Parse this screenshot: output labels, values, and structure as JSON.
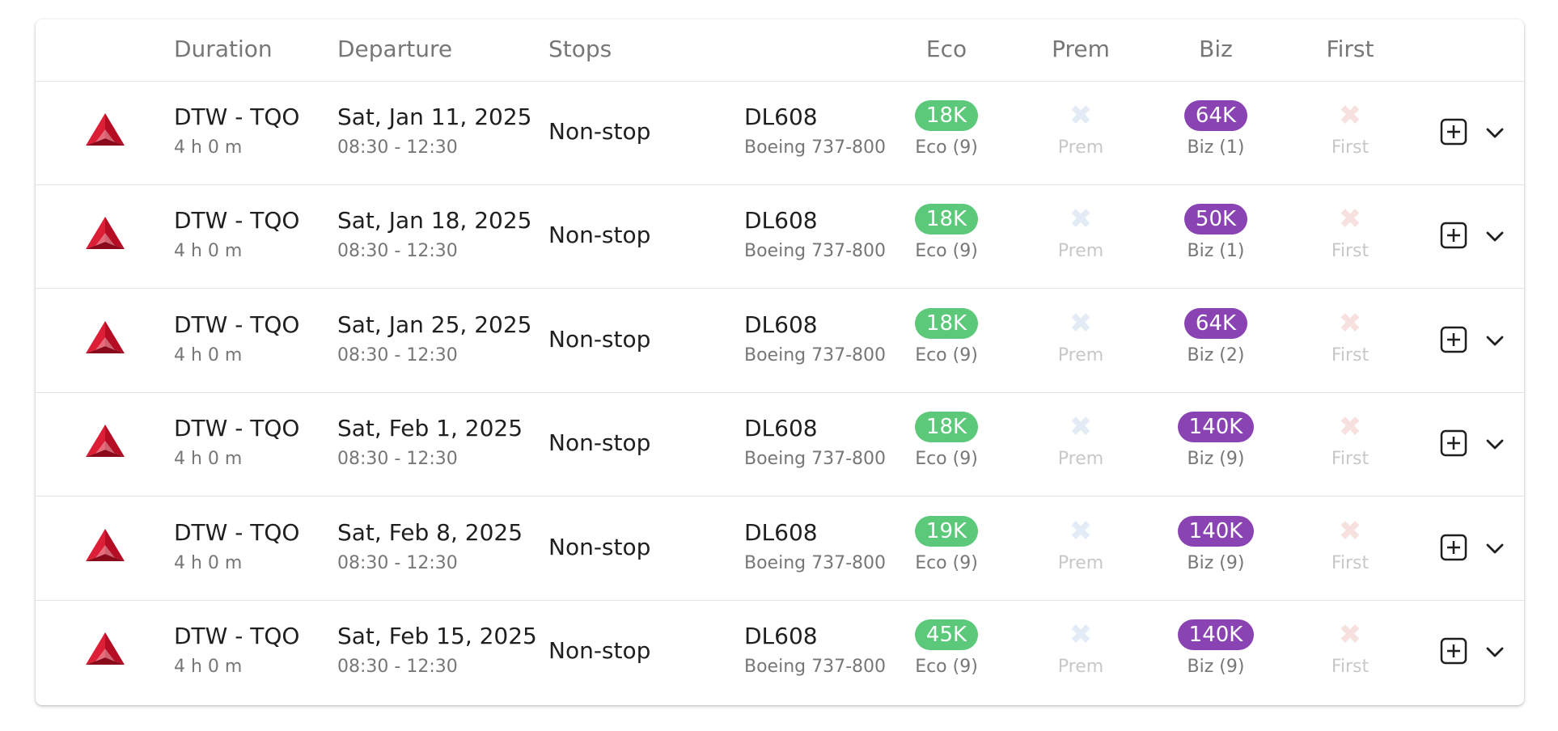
{
  "header": {
    "duration": "Duration",
    "departure": "Departure",
    "stops": "Stops",
    "eco": "Eco",
    "prem": "Prem",
    "biz": "Biz",
    "first": "First"
  },
  "colors": {
    "eco_available": "#5cc87a",
    "biz_available": "#8a43b3",
    "prem_unavailable": "#e3ecf5",
    "first_unavailable": "#f6e1df",
    "airline_brand": "#c8102e"
  },
  "icons": {
    "airline_logo": "delta-logo-icon",
    "add": "plus-square-icon",
    "expand": "chevron-down-icon",
    "unavailable": "x-icon"
  },
  "flights": [
    {
      "route": "DTW - TQO",
      "duration": "4 h 0 m",
      "date": "Sat, Jan 11, 2025",
      "time": "08:30 - 12:30",
      "stops": "Non-stop",
      "flight_number": "DL608",
      "aircraft": "Boeing 737-800 · ",
      "eco": {
        "points": "18K",
        "label": "Eco (9)"
      },
      "prem": {
        "label": "Prem"
      },
      "biz": {
        "points": "64K",
        "label": "Biz (1)"
      },
      "first": {
        "label": "First"
      }
    },
    {
      "route": "DTW - TQO",
      "duration": "4 h 0 m",
      "date": "Sat, Jan 18, 2025",
      "time": "08:30 - 12:30",
      "stops": "Non-stop",
      "flight_number": "DL608",
      "aircraft": "Boeing 737-800 · ",
      "eco": {
        "points": "18K",
        "label": "Eco (9)"
      },
      "prem": {
        "label": "Prem"
      },
      "biz": {
        "points": "50K",
        "label": "Biz (1)"
      },
      "first": {
        "label": "First"
      }
    },
    {
      "route": "DTW - TQO",
      "duration": "4 h 0 m",
      "date": "Sat, Jan 25, 2025",
      "time": "08:30 - 12:30",
      "stops": "Non-stop",
      "flight_number": "DL608",
      "aircraft": "Boeing 737-800 · ",
      "eco": {
        "points": "18K",
        "label": "Eco (9)"
      },
      "prem": {
        "label": "Prem"
      },
      "biz": {
        "points": "64K",
        "label": "Biz (2)"
      },
      "first": {
        "label": "First"
      }
    },
    {
      "route": "DTW - TQO",
      "duration": "4 h 0 m",
      "date": "Sat, Feb 1, 2025",
      "time": "08:30 - 12:30",
      "stops": "Non-stop",
      "flight_number": "DL608",
      "aircraft": "Boeing 737-800 · ",
      "eco": {
        "points": "18K",
        "label": "Eco (9)"
      },
      "prem": {
        "label": "Prem"
      },
      "biz": {
        "points": "140K",
        "label": "Biz (9)"
      },
      "first": {
        "label": "First"
      }
    },
    {
      "route": "DTW - TQO",
      "duration": "4 h 0 m",
      "date": "Sat, Feb 8, 2025",
      "time": "08:30 - 12:30",
      "stops": "Non-stop",
      "flight_number": "DL608",
      "aircraft": "Boeing 737-800 · ",
      "eco": {
        "points": "19K",
        "label": "Eco (9)"
      },
      "prem": {
        "label": "Prem"
      },
      "biz": {
        "points": "140K",
        "label": "Biz (9)"
      },
      "first": {
        "label": "First"
      }
    },
    {
      "route": "DTW - TQO",
      "duration": "4 h 0 m",
      "date": "Sat, Feb 15, 2025",
      "time": "08:30 - 12:30",
      "stops": "Non-stop",
      "flight_number": "DL608",
      "aircraft": "Boeing 737-800 · ",
      "eco": {
        "points": "45K",
        "label": "Eco (9)"
      },
      "prem": {
        "label": "Prem"
      },
      "biz": {
        "points": "140K",
        "label": "Biz (9)"
      },
      "first": {
        "label": "First"
      }
    }
  ]
}
